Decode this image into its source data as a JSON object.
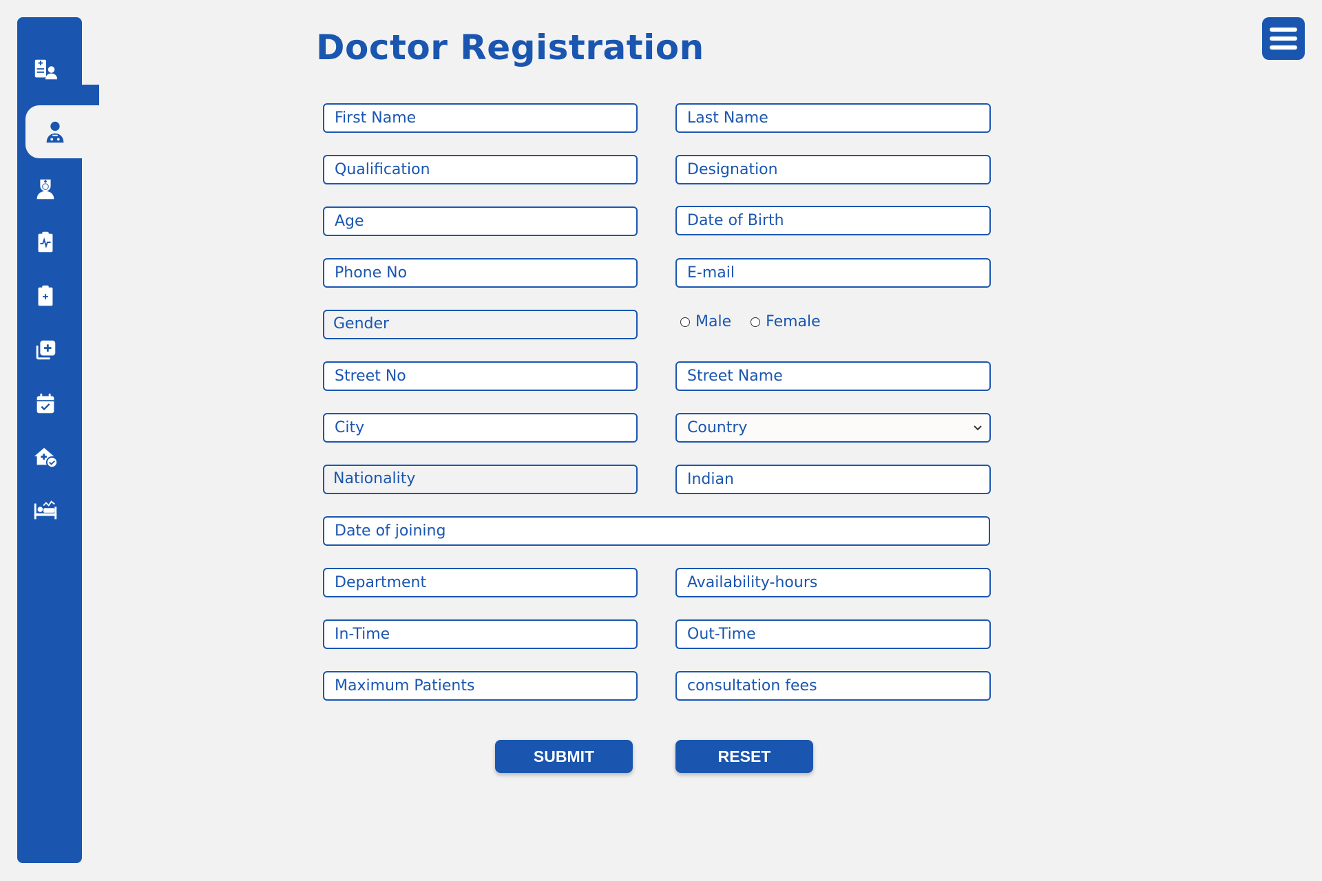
{
  "page": {
    "title": "Doctor Registration"
  },
  "sidebar": {
    "items": [
      {
        "icon": "patient-record-icon"
      },
      {
        "icon": "doctor-icon",
        "active": true
      },
      {
        "icon": "nurse-icon"
      },
      {
        "icon": "clipboard-pulse-icon"
      },
      {
        "icon": "clipboard-plus-icon"
      },
      {
        "icon": "copy-plus-icon"
      },
      {
        "icon": "calendar-check-icon"
      },
      {
        "icon": "house-medical-check-icon"
      },
      {
        "icon": "hospital-bed-icon"
      }
    ]
  },
  "header": {
    "menu_icon": "hamburger-menu-icon"
  },
  "form": {
    "first_name": "First Name",
    "last_name": "Last Name",
    "qualification": "Qualification",
    "designation": "Designation",
    "age": "Age",
    "dob": "Date of Birth",
    "phone": "Phone No",
    "email": "E-mail",
    "gender": "Gender",
    "gender_male": "Male",
    "gender_female": "Female",
    "street_no": "Street No",
    "street_name": "Street Name",
    "city": "City",
    "country": "Country",
    "nationality": "Nationality",
    "nationality_value": "Indian",
    "doj": "Date of joining",
    "department": "Department",
    "availability": "Availability-hours",
    "in_time": "In-Time",
    "out_time": "Out-Time",
    "max_patients": "Maximum Patients",
    "fees": "consultation fees",
    "submit": "SUBMIT",
    "reset": "RESET"
  },
  "colors": {
    "primary": "#1a56b0",
    "background": "#f2f2f2"
  }
}
